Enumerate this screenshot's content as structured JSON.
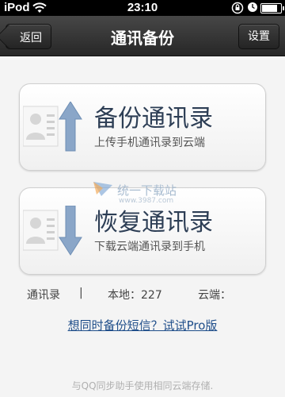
{
  "status_bar": {
    "carrier": "iPod",
    "time": "23:10",
    "battery_level": 0.9
  },
  "nav": {
    "back_label": "返回",
    "title": "通讯备份",
    "settings_label": "设置"
  },
  "backup_card": {
    "title": "备份通讯录",
    "subtitle": "上传手机通讯录到云端",
    "arrow_direction": "up"
  },
  "restore_card": {
    "title": "恢复通讯录",
    "subtitle": "下载云端通讯录到手机",
    "arrow_direction": "down"
  },
  "watermark": {
    "text": "统一下载站",
    "url": "www.3987.com"
  },
  "stats": {
    "label": "通讯录",
    "separator": "|",
    "local_label": "本地：227",
    "cloud_label": "云端："
  },
  "promo_link": "想同时备份短信？试试Pro版",
  "footer_note": "与QQ同步助手使用相同云端存储.",
  "colors": {
    "title_text": "#2d3e55",
    "link": "#1f4e8a",
    "arrow_fill": "#8aa6c8"
  }
}
